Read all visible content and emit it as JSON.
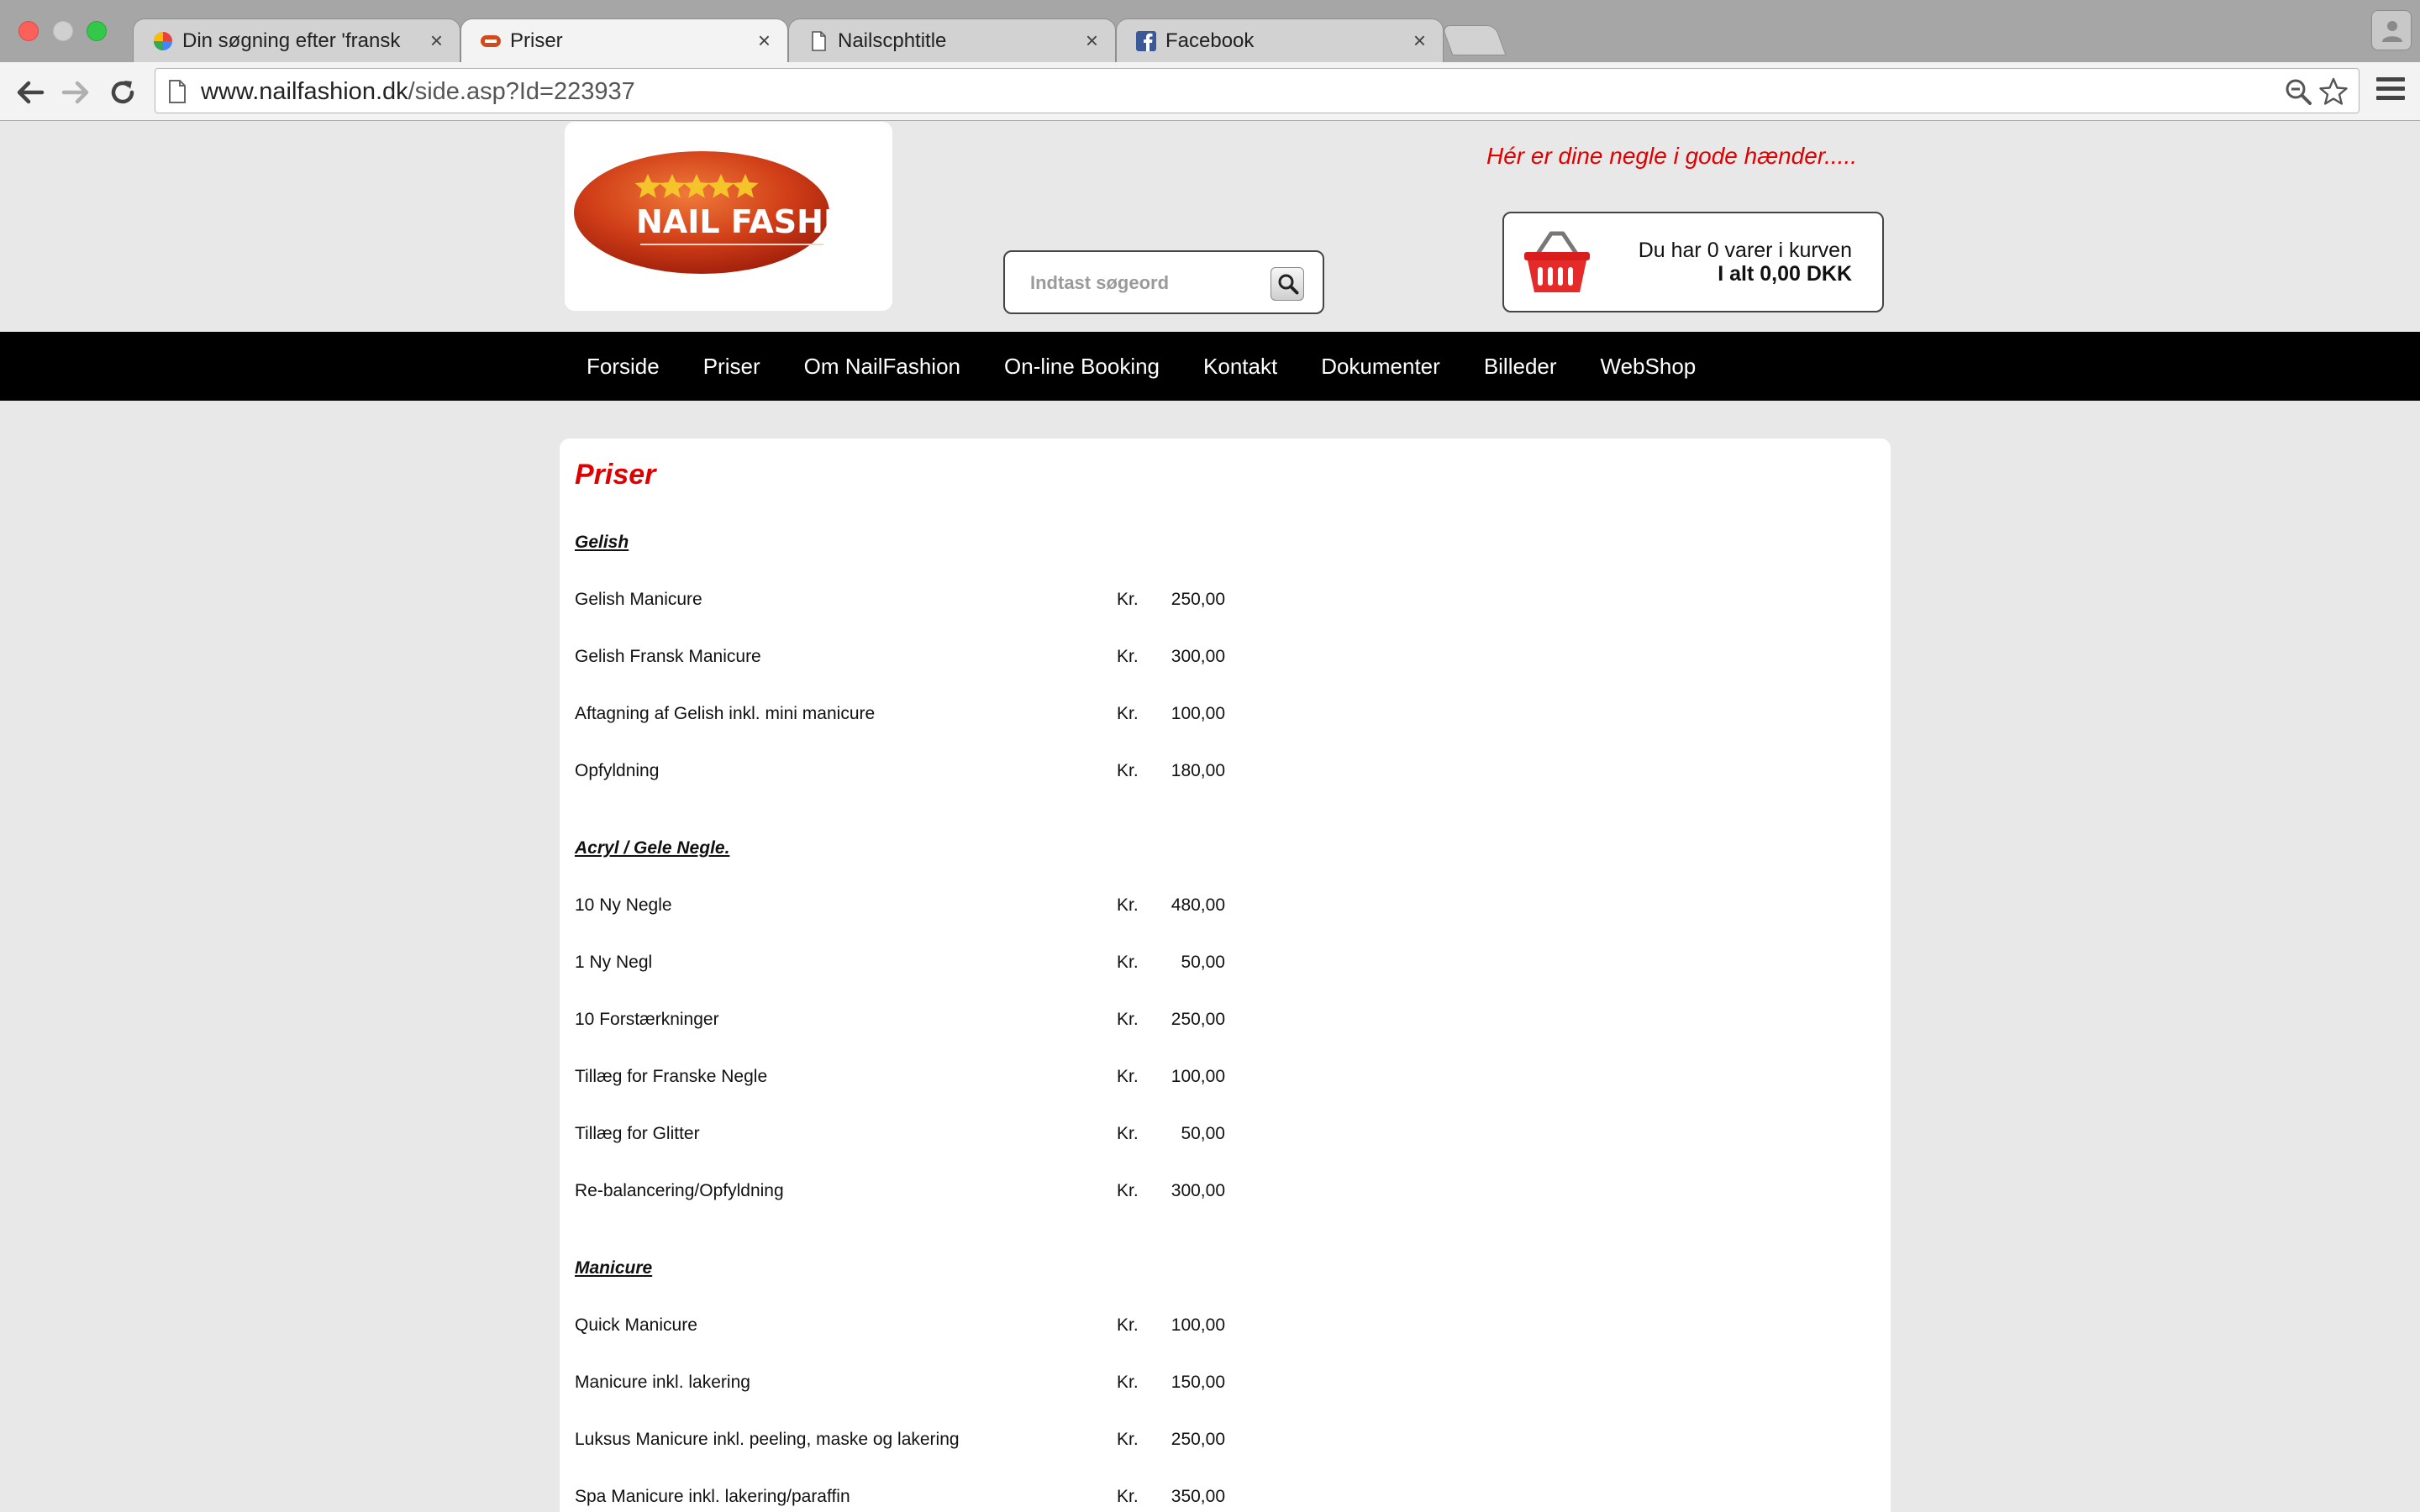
{
  "browser": {
    "tabs": [
      {
        "title": "Din søgning efter 'fransk m",
        "icon": "google-icon"
      },
      {
        "title": "Priser",
        "icon": "nailfashion-favicon",
        "active": true
      },
      {
        "title": "Nailscphtitle",
        "icon": "page-icon"
      },
      {
        "title": "Facebook",
        "icon": "facebook-icon"
      }
    ],
    "close_glyph": "×",
    "url_domain": "www.nailfashion.dk",
    "url_path": "/side.asp?Id=223937"
  },
  "header": {
    "logo_text": "NAIL FASHION",
    "tagline": "Hér er dine negle i gode hænder.....",
    "search_placeholder": "Indtast søgeord",
    "cart_line1": "Du har 0 varer i kurven",
    "cart_line2": "I alt 0,00 DKK"
  },
  "nav": [
    "Forside",
    "Priser",
    "Om NailFashion",
    "On-line Booking",
    "Kontakt",
    "Dokumenter",
    "Billeder",
    "WebShop"
  ],
  "content": {
    "title": "Priser",
    "currency": "Kr.",
    "sections": [
      {
        "title": "Gelish",
        "items": [
          {
            "name": "Gelish Manicure",
            "price": "250,00"
          },
          {
            "name": "Gelish Fransk Manicure",
            "price": "300,00"
          },
          {
            "name": "Aftagning af Gelish inkl. mini manicure",
            "price": "100,00"
          },
          {
            "name": "Opfyldning",
            "price": "180,00"
          }
        ]
      },
      {
        "title": "Acryl / Gele Negle.",
        "items": [
          {
            "name": "10 Ny Negle",
            "price": "480,00"
          },
          {
            "name": "1 Ny Negl",
            "price": "50,00"
          },
          {
            "name": "10 Forstærkninger",
            "price": "250,00"
          },
          {
            "name": "Tillæg for Franske Negle",
            "price": "100,00"
          },
          {
            "name": "Tillæg for Glitter",
            "price": "50,00"
          },
          {
            "name": "Re-balancering/Opfyldning",
            "price": "300,00"
          }
        ]
      },
      {
        "title": "Manicure",
        "items": [
          {
            "name": "Quick Manicure",
            "price": "100,00"
          },
          {
            "name": "Manicure inkl. lakering",
            "price": "150,00"
          },
          {
            "name": "Luksus Manicure inkl. peeling, maske og lakering",
            "price": "250,00"
          },
          {
            "name": "Spa Manicure inkl. lakering/paraffin",
            "price": "350,00"
          }
        ]
      }
    ]
  },
  "colors": {
    "accent_red": "#e00000",
    "nav_bg": "#000000",
    "page_bg": "#e8e8e8"
  }
}
